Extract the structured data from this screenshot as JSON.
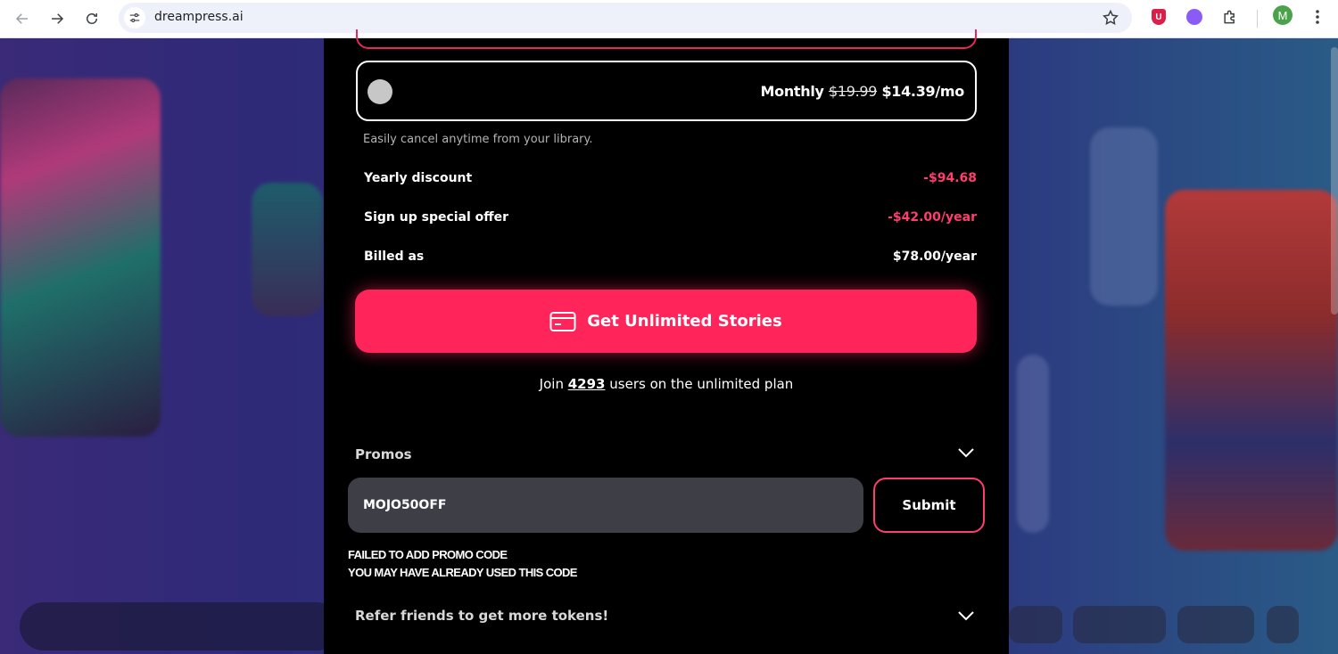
{
  "browser": {
    "url": "dreampress.ai",
    "avatar_letter": "M",
    "extension_shield_letter": "U"
  },
  "plan": {
    "label": "Monthly",
    "old_price": "$19.99",
    "new_price": "$14.39/mo",
    "cancel_note": "Easily cancel anytime from your library."
  },
  "breakdown": [
    {
      "label": "Yearly discount",
      "value": "-$94.68"
    },
    {
      "label": "Sign up special offer",
      "value": "-$42.00/year"
    },
    {
      "label": "Billed as",
      "value": "$78.00/year"
    }
  ],
  "cta": {
    "label": "Get Unlimited Stories"
  },
  "join": {
    "prefix": "Join",
    "count": "4293",
    "suffix": "users on the unlimited plan"
  },
  "promos": {
    "title": "Promos",
    "input_value": "MOJO50OFF",
    "submit_label": "Submit",
    "error_line1": "FAILED TO ADD PROMO CODE",
    "error_line2": "YOU MAY HAVE ALREADY USED THIS CODE"
  },
  "refer": {
    "title": "Refer friends to get more tokens!"
  },
  "colors": {
    "accent": "#ff2459",
    "accent_text": "#ff3d6e",
    "modal_bg": "#000000",
    "input_bg": "#3e3e46"
  }
}
